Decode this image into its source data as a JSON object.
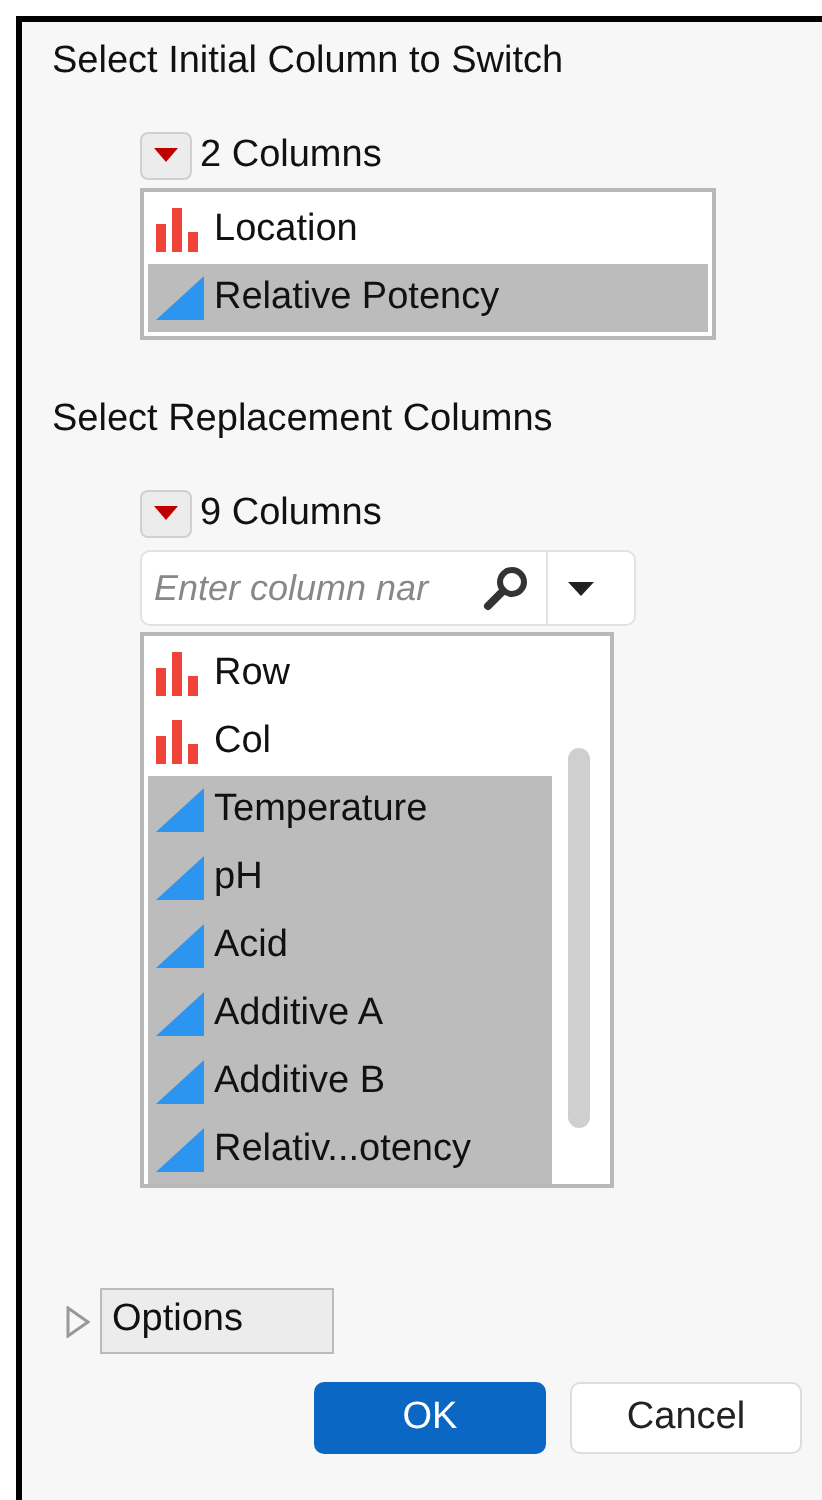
{
  "initial_section": {
    "title": "Select Initial Column to Switch",
    "count_label": "2 Columns",
    "columns": [
      {
        "name": "Location",
        "kind": "nominal",
        "selected": false
      },
      {
        "name": "Relative Potency",
        "kind": "continuous",
        "selected": true
      }
    ]
  },
  "replacement_section": {
    "title": "Select Replacement Columns",
    "count_label": "9 Columns",
    "search": {
      "placeholder": "Enter column nar"
    },
    "columns": [
      {
        "name": "Row",
        "kind": "nominal",
        "selected": false
      },
      {
        "name": "Col",
        "kind": "nominal",
        "selected": false
      },
      {
        "name": "Temperature",
        "kind": "continuous",
        "selected": true
      },
      {
        "name": "pH",
        "kind": "continuous",
        "selected": true
      },
      {
        "name": "Acid",
        "kind": "continuous",
        "selected": true
      },
      {
        "name": "Additive A",
        "kind": "continuous",
        "selected": true
      },
      {
        "name": "Additive B",
        "kind": "continuous",
        "selected": true
      },
      {
        "name": "Relativ...otency",
        "kind": "continuous",
        "selected": true
      }
    ]
  },
  "options": {
    "label": "Options",
    "expanded": false
  },
  "buttons": [
    {
      "label": "OK",
      "kind": "primary"
    },
    {
      "label": "Cancel",
      "kind": "secondary"
    }
  ]
}
